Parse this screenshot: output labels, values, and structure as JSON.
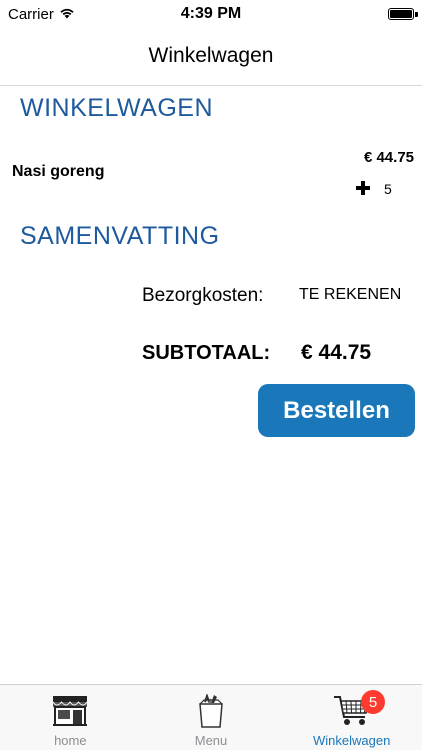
{
  "status_bar": {
    "carrier": "Carrier",
    "time": "4:39 PM"
  },
  "nav": {
    "title": "Winkelwagen"
  },
  "cart": {
    "section_title": "WINKELWAGEN",
    "items": [
      {
        "name": "Nasi goreng",
        "price": "€ 44.75",
        "quantity": "5"
      }
    ]
  },
  "summary": {
    "section_title": "SAMENVATTING",
    "delivery_label": "Bezorgkosten:",
    "delivery_value": "TE REKENEN",
    "subtotal_label": "SUBTOTAAL:",
    "subtotal_value": "€ 44.75"
  },
  "order_button": {
    "label": "Bestellen",
    "color": "#1a77b9"
  },
  "tab_bar": {
    "tabs": [
      {
        "label": "home",
        "icon": "store-icon",
        "active": false
      },
      {
        "label": "Menu",
        "icon": "grocery-bag-icon",
        "active": false
      },
      {
        "label": "Winkelwagen",
        "icon": "shopping-cart-icon",
        "active": true,
        "badge": "5"
      }
    ]
  },
  "colors": {
    "accent": "#1e5a9c",
    "badge": "#ff3b30"
  }
}
